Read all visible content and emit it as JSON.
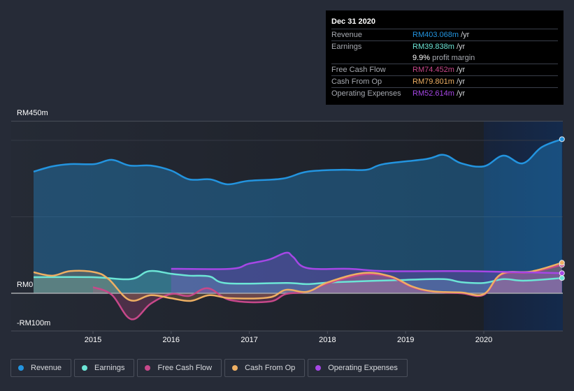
{
  "tooltip": {
    "date": "Dec 31 2020",
    "rows": [
      {
        "label": "Revenue",
        "value": "RM403.068m",
        "unit": " /yr",
        "color": "#2394df"
      },
      {
        "label": "Earnings",
        "value": "RM39.838m",
        "unit": " /yr",
        "color": "#6ce5d6"
      },
      {
        "label": "",
        "value": "9.9%",
        "unit": " profit margin",
        "color": "#ffffff"
      },
      {
        "label": "Free Cash Flow",
        "value": "RM74.452m",
        "unit": " /yr",
        "color": "#c7488a"
      },
      {
        "label": "Cash From Op",
        "value": "RM79.801m",
        "unit": " /yr",
        "color": "#eeaf63"
      },
      {
        "label": "Operating Expenses",
        "value": "RM52.614m",
        "unit": " /yr",
        "color": "#a647e6"
      }
    ]
  },
  "chart_data": {
    "type": "area",
    "title": "",
    "xlabel": "",
    "ylabel": "",
    "y_unit": "RM m",
    "ylim": [
      -100,
      450
    ],
    "xlim": [
      2014.24,
      2021.0
    ],
    "y_tick_labels": [
      {
        "value": 450,
        "label": "RM450m"
      },
      {
        "value": 0,
        "label": "RM0"
      },
      {
        "value": -100,
        "label": "-RM100m"
      }
    ],
    "gridlines": [
      450,
      400,
      200,
      0
    ],
    "x_ticks": [
      2015,
      2016,
      2017,
      2018,
      2019,
      2020
    ],
    "highlight_range": [
      2020.0,
      2021.0
    ],
    "legend_position": "bottom-left",
    "series": [
      {
        "name": "Revenue",
        "color": "#2394df",
        "x": [
          2014.24,
          2014.48,
          2014.71,
          2015.02,
          2015.24,
          2015.47,
          2015.74,
          2016.0,
          2016.23,
          2016.5,
          2016.72,
          2016.99,
          2017.43,
          2017.74,
          2018.19,
          2018.5,
          2018.72,
          2019.26,
          2019.49,
          2019.71,
          2020.0,
          2020.25,
          2020.5,
          2020.74,
          2021.0
        ],
        "values": [
          318,
          332,
          338,
          338,
          349,
          334,
          334,
          321,
          298,
          298,
          285,
          294,
          300,
          318,
          323,
          323,
          338,
          351,
          362,
          340,
          332,
          360,
          340,
          382,
          403.068
        ]
      },
      {
        "name": "Earnings",
        "color": "#6ce5d6",
        "x": [
          2014.24,
          2015.0,
          2015.48,
          2015.72,
          2016.0,
          2016.23,
          2016.49,
          2016.72,
          2017.48,
          2017.74,
          2018.1,
          2019.0,
          2019.49,
          2019.71,
          2020.0,
          2020.25,
          2020.52,
          2021.0
        ],
        "values": [
          42,
          42,
          37,
          58,
          51,
          46,
          44,
          26,
          27,
          24,
          29,
          35,
          37,
          29,
          27,
          37,
          33,
          39.838
        ]
      },
      {
        "name": "Free Cash Flow",
        "color": "#c7488a",
        "x": [
          2015.0,
          2015.24,
          2015.49,
          2015.74,
          2016.0,
          2016.23,
          2016.47,
          2016.76,
          2017.25,
          2017.47,
          2017.74,
          2018.01,
          2018.46,
          2018.81,
          2019.08,
          2019.35,
          2019.71,
          2020.0,
          2020.23,
          2020.61,
          2021.0
        ],
        "values": [
          16,
          -4,
          -68,
          -27,
          -2,
          -7,
          13,
          -18,
          -22,
          -2,
          4,
          26,
          49,
          42,
          16,
          4,
          0,
          -4,
          49,
          55,
          74.452
        ]
      },
      {
        "name": "Cash From Op",
        "color": "#eeaf63",
        "x": [
          2014.24,
          2014.48,
          2014.71,
          2015.02,
          2015.2,
          2015.47,
          2015.74,
          2016.0,
          2016.25,
          2016.49,
          2016.76,
          2017.25,
          2017.47,
          2017.74,
          2018.01,
          2018.46,
          2018.81,
          2019.08,
          2019.35,
          2019.71,
          2020.0,
          2020.23,
          2020.61,
          2021.0
        ],
        "values": [
          55,
          46,
          58,
          55,
          37,
          -18,
          -5,
          -13,
          -20,
          -5,
          -13,
          -11,
          9,
          4,
          29,
          53,
          44,
          18,
          5,
          2,
          -2,
          51,
          57,
          79.801
        ]
      },
      {
        "name": "Operating Expenses",
        "color": "#a647e6",
        "x": [
          2016.0,
          2016.76,
          2016.99,
          2017.25,
          2017.47,
          2017.56,
          2017.74,
          2018.28,
          2018.72,
          2019.53,
          2020.0,
          2021.0
        ],
        "values": [
          64,
          64,
          77,
          88,
          106,
          95,
          66,
          64,
          58,
          58,
          57,
          52.614
        ]
      }
    ]
  },
  "legend": [
    {
      "label": "Revenue",
      "color": "#2394df"
    },
    {
      "label": "Earnings",
      "color": "#6ce5d6"
    },
    {
      "label": "Free Cash Flow",
      "color": "#c7488a"
    },
    {
      "label": "Cash From Op",
      "color": "#eeaf63"
    },
    {
      "label": "Operating Expenses",
      "color": "#a647e6"
    }
  ]
}
